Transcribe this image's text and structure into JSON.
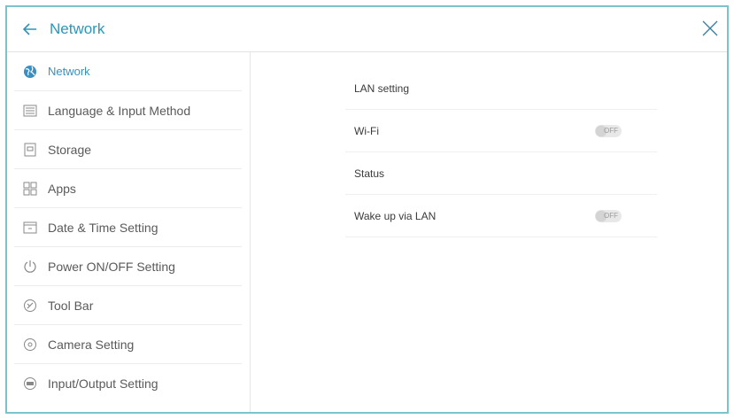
{
  "header": {
    "title": "Network",
    "back_icon": "arrow-left-icon",
    "close_icon": "close-icon"
  },
  "colors": {
    "accent": "#2d96b8",
    "frame_border": "#7cc3cc"
  },
  "sidebar": {
    "items": [
      {
        "label": "Network",
        "icon": "globe-icon",
        "active": true
      },
      {
        "label": "Language & Input Method",
        "icon": "keyboard-icon",
        "active": false
      },
      {
        "label": "Storage",
        "icon": "storage-icon",
        "active": false
      },
      {
        "label": "Apps",
        "icon": "apps-grid-icon",
        "active": false
      },
      {
        "label": "Date & Time Setting",
        "icon": "calendar-icon",
        "active": false
      },
      {
        "label": "Power ON/OFF Setting",
        "icon": "power-icon",
        "active": false
      },
      {
        "label": "Tool Bar",
        "icon": "toolbar-icon",
        "active": false
      },
      {
        "label": "Camera Setting",
        "icon": "camera-icon",
        "active": false
      },
      {
        "label": "Input/Output Setting",
        "icon": "input-output-icon",
        "active": false
      }
    ]
  },
  "main": {
    "rows": [
      {
        "label": "LAN setting"
      },
      {
        "label": "Wi-Fi",
        "toggle": "OFF"
      },
      {
        "label": "Status"
      },
      {
        "label": "Wake up via LAN",
        "toggle": "OFF"
      }
    ]
  }
}
